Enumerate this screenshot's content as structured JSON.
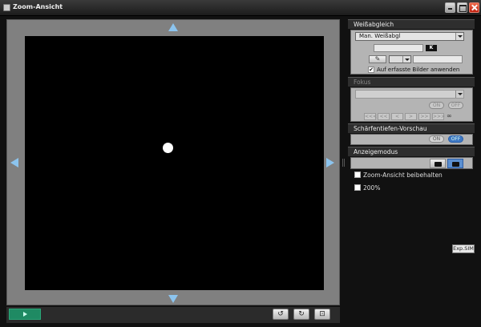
{
  "window": {
    "title": "Zoom-Ansicht"
  },
  "white_balance": {
    "header": "Weißabgleich",
    "mode_selected": "Man. Weißabgl",
    "kelvin_badge": "K",
    "apply_label": "Auf erfasste Bilder anwenden",
    "apply_checked": true,
    "apply_check_glyph": "✔",
    "eyedropper_glyph": "✎"
  },
  "focus": {
    "header": "Fokus",
    "on_label": "ON",
    "off_label": "OFF",
    "nav_buttons": [
      "<<<",
      "<<",
      "<",
      ">",
      ">>",
      ">>>"
    ],
    "infinity": "∞"
  },
  "dof_preview": {
    "header": "Schärfentiefen-Vorschau",
    "on_label": "ON",
    "off_label": "OFF",
    "active": "off"
  },
  "display_mode": {
    "header": "Anzeigemodus",
    "buttons": [
      "camera-icon",
      "monitor-icon"
    ],
    "active": "monitor-icon"
  },
  "options": {
    "keep_zoom": {
      "label": "Zoom-Ansicht beibehalten",
      "checked": false
    },
    "zoom_200": {
      "label": "200%",
      "checked": false
    }
  },
  "expsim": {
    "label": "Exp.SIM"
  },
  "toolbar": {
    "rotate_left_glyph": "↺",
    "rotate_right_glyph": "↻",
    "fit_glyph": "⊡"
  },
  "colors": {
    "accent": "#3e78c4",
    "play": "#1f8a63",
    "arrow": "#8cc4ee"
  }
}
